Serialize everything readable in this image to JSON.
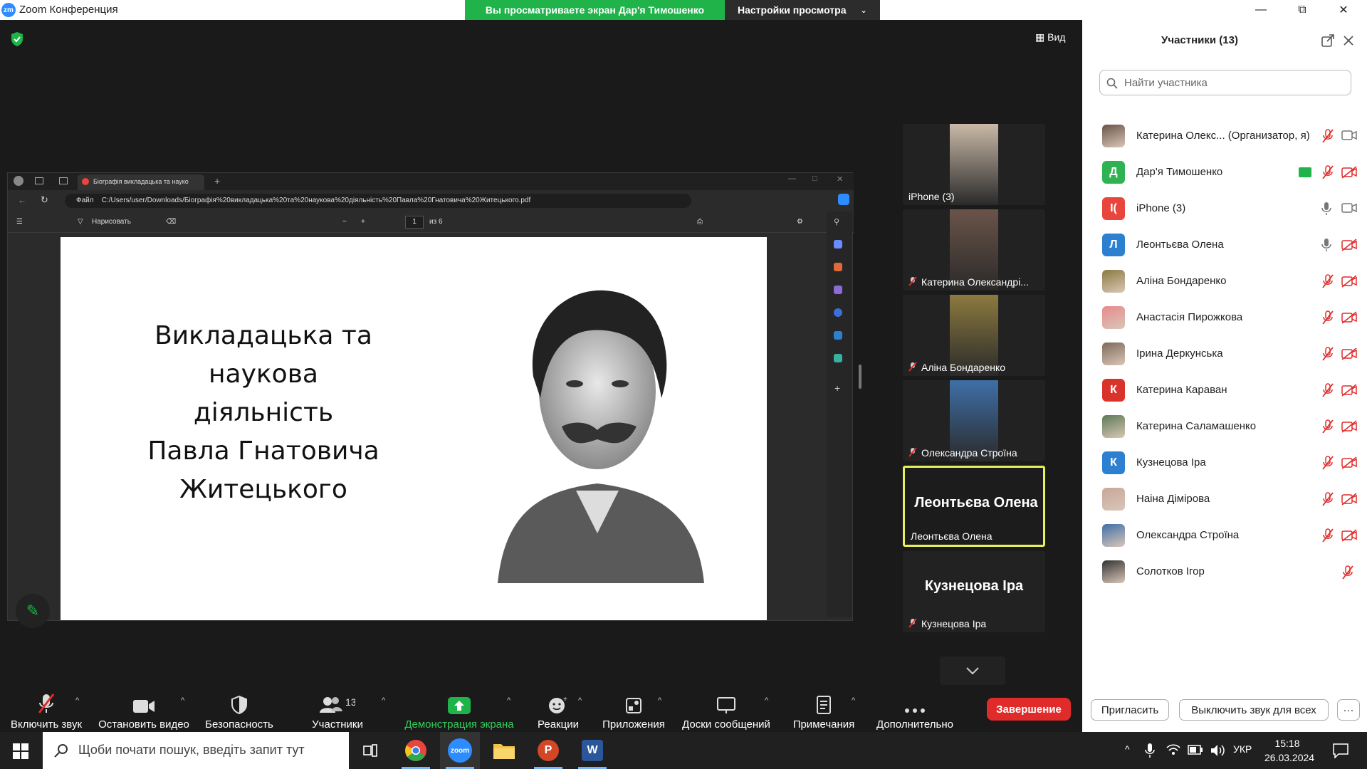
{
  "titlebar": {
    "app_title": "Zoom Конференция",
    "logo_text": "zm",
    "share_banner": "Вы просматриваете экран Дар'я Тимошенко",
    "view_settings": "Настройки просмотра"
  },
  "stage": {
    "view_label": "Вид"
  },
  "shared_screen": {
    "tab_title": "Біографія викладацька та науко",
    "file_label": "Файл",
    "address": "C:/Users/user/Downloads/Біографія%20викладацька%20та%20наукова%20діяльність%20Павла%20Гнатовича%20Житецького.pdf",
    "draw_label": "Нарисовать",
    "page_current": "1",
    "page_total": "из 6",
    "slide_lines": [
      "Викладацька та наукова",
      "діяльність",
      "Павла Гнатовича",
      "Житецького"
    ]
  },
  "thumbnails": [
    {
      "label": "iPhone (3)",
      "muted": false,
      "photo": true,
      "color": "#c9b9a7"
    },
    {
      "label": "Катерина Олександрі...",
      "muted": true,
      "photo": true,
      "color": "#6a5449"
    },
    {
      "label": "Аліна Бондаренко",
      "muted": true,
      "photo": true,
      "color": "#8c7a3f"
    },
    {
      "label": "Олександра Строїна",
      "muted": true,
      "photo": true,
      "color": "#3f6fa8"
    },
    {
      "label": "Леонтьєва Олена",
      "big": "Леонтьєва Олена",
      "muted": false,
      "active": true
    },
    {
      "label": "Кузнецова Іра",
      "big": "Кузнецова Іра",
      "muted": true
    }
  ],
  "toolbar": {
    "unmute": "Включить звук",
    "stop_video": "Остановить видео",
    "security": "Безопасность",
    "participants": "Участники",
    "participants_count": "13",
    "share": "Демонстрация экрана",
    "reactions": "Реакции",
    "apps": "Приложения",
    "whiteboards": "Доски сообщений",
    "notes": "Примечания",
    "more": "Дополнительно",
    "end": "Завершение"
  },
  "panel": {
    "title": "Участники (13)",
    "search_placeholder": "Найти участника",
    "invite": "Пригласить",
    "mute_all": "Выключить звук для всех",
    "more": "···",
    "participants": [
      {
        "name": "Катерина Олекс... (Организатор, я)",
        "initial": "",
        "color": "#6a5449",
        "mic": "muted",
        "cam": "on",
        "share": false
      },
      {
        "name": "Дар'я Тимошенко",
        "initial": "Д",
        "color": "#2fb352",
        "mic": "muted",
        "cam": "off",
        "share": true
      },
      {
        "name": "iPhone (3)",
        "initial": "I(",
        "color": "#e8453c",
        "mic": "on",
        "cam": "on",
        "share": false
      },
      {
        "name": "Леонтьєва Олена",
        "initial": "Л",
        "color": "#2d7fd0",
        "mic": "on",
        "cam": "off",
        "share": false
      },
      {
        "name": "Аліна Бондаренко",
        "initial": "",
        "color": "#8c7a3f",
        "mic": "muted",
        "cam": "off",
        "share": false
      },
      {
        "name": "Анастасія Пирожкова",
        "initial": "",
        "color": "#e8898b",
        "mic": "muted",
        "cam": "off",
        "share": false
      },
      {
        "name": "Ірина Деркунська",
        "initial": "",
        "color": "#7d6a5a",
        "mic": "muted",
        "cam": "off",
        "share": false
      },
      {
        "name": "Катерина Караван",
        "initial": "К",
        "color": "#d9342b",
        "mic": "muted",
        "cam": "off",
        "share": false
      },
      {
        "name": "Катерина Саламашенко",
        "initial": "",
        "color": "#5b7a55",
        "mic": "muted",
        "cam": "off",
        "share": false
      },
      {
        "name": "Кузнецова Іра",
        "initial": "К",
        "color": "#2d7fd0",
        "mic": "muted",
        "cam": "off",
        "share": false
      },
      {
        "name": "Наіна Дімірова",
        "initial": "",
        "color": "#c7a79a",
        "mic": "muted",
        "cam": "off",
        "share": false
      },
      {
        "name": "Олександра Строїна",
        "initial": "",
        "color": "#3f6fa8",
        "mic": "muted",
        "cam": "off",
        "share": false
      },
      {
        "name": "Солотков Ігор",
        "initial": "",
        "color": "#333333",
        "mic": "muted",
        "cam": "none",
        "share": false
      }
    ]
  },
  "taskbar": {
    "search_placeholder": "Щоби почати пошук, введіть запит тут",
    "lang": "УКР",
    "time": "15:18",
    "date": "26.03.2024",
    "zoom_label": "zoom"
  }
}
